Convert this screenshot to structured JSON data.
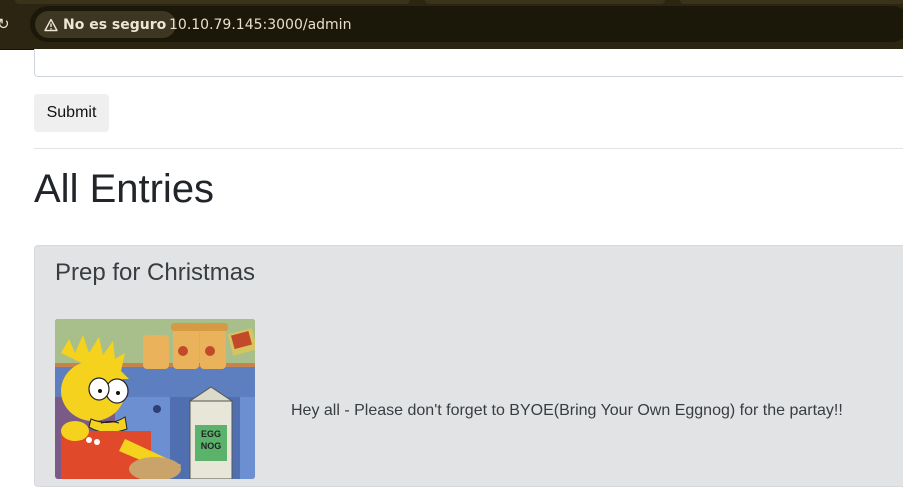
{
  "browser": {
    "security_label": "No es seguro",
    "url": "10.10.79.145:3000/admin"
  },
  "form": {
    "submit_label": "Submit"
  },
  "page": {
    "heading": "All Entries"
  },
  "entries": [
    {
      "title": "Prep for Christmas",
      "image_lettering": "EGG NOG",
      "text": "Hey all - Please don't forget to BYOE(Bring Your Own Eggnog) for the partay!!"
    }
  ],
  "colors": {
    "browser_bar": "#2b2512",
    "card_background": "#e2e3e5",
    "button_background": "#efefef"
  }
}
